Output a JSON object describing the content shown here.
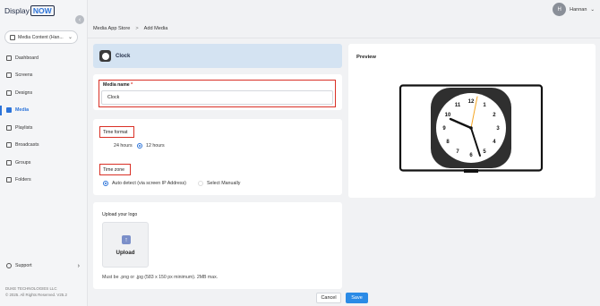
{
  "brand": {
    "name_prefix": "Display",
    "name_suffix": "NOW"
  },
  "workspace": {
    "label": "Media Content (Han..."
  },
  "sidebar": {
    "items": [
      {
        "label": "Dashboard",
        "icon": "dashboard-icon"
      },
      {
        "label": "Screens",
        "icon": "screens-icon"
      },
      {
        "label": "Designs",
        "icon": "designs-icon"
      },
      {
        "label": "Media",
        "icon": "media-icon",
        "active": true
      },
      {
        "label": "Playlists",
        "icon": "playlists-icon"
      },
      {
        "label": "Broadcasts",
        "icon": "broadcasts-icon"
      },
      {
        "label": "Groups",
        "icon": "groups-icon"
      },
      {
        "label": "Folders",
        "icon": "folders-icon"
      }
    ],
    "support_label": "Support",
    "company": "DUKE TECHNOLOGIES LLC",
    "rights": "© 2025. All Rights Reserved. V25.2"
  },
  "user": {
    "initial": "H",
    "name": "Hannan"
  },
  "breadcrumb": {
    "parent": "Media App Store",
    "separator": ">",
    "current": "Add Media"
  },
  "app": {
    "name": "Clock"
  },
  "media_name": {
    "label": "Media name",
    "required_mark": "*",
    "value": "Clock"
  },
  "time_format": {
    "label": "Time format",
    "options": [
      {
        "label": "24 hours",
        "checked": false
      },
      {
        "label": "12 hours",
        "checked": true
      }
    ]
  },
  "time_zone": {
    "label": "Time zone",
    "options": [
      {
        "label": "Auto detect (via screen IP Address)",
        "checked": true
      },
      {
        "label": "Select Manually",
        "checked": false
      }
    ]
  },
  "upload": {
    "title": "Upload your logo",
    "button_label": "Upload",
    "hint": "Must be .png or .jpg (583 x 150 px minimum). 2MB max."
  },
  "preview": {
    "title": "Preview",
    "clock_numbers": [
      "12",
      "1",
      "2",
      "3",
      "4",
      "5",
      "6",
      "7",
      "8",
      "9",
      "10",
      "11"
    ],
    "second_hand_color": "#f5a623"
  },
  "actions": {
    "cancel_label": "Cancel",
    "save_label": "Save"
  },
  "colors": {
    "accent": "#2b73d9",
    "highlight_outline": "#d93025",
    "app_header_bg": "#d4e3f2"
  }
}
